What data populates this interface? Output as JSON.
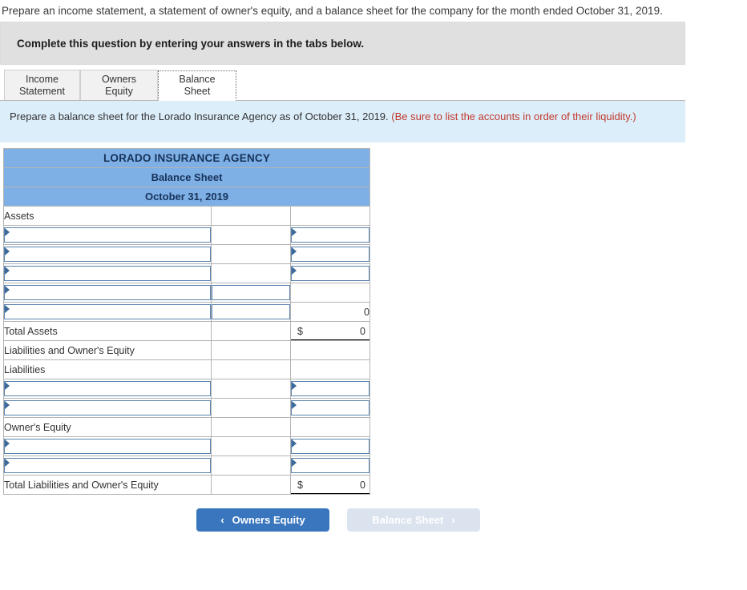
{
  "prompt": {
    "text": "Prepare an income statement, a statement of owner's equity, and a balance sheet for the company for the month ended October 31, 2019."
  },
  "gray_banner": {
    "text": "Complete this question by entering your answers in the tabs below."
  },
  "tabs": {
    "items": [
      {
        "label": "Income\nStatement",
        "active": false
      },
      {
        "label": "Owners Equity",
        "active": false
      },
      {
        "label": "Balance Sheet",
        "active": true
      }
    ]
  },
  "blue_banner": {
    "text": "Prepare a balance sheet for the Lorado Insurance Agency as of October 31, 2019. ",
    "hint": "(Be sure to list the accounts in order of their liquidity.)"
  },
  "sheet": {
    "title_line1": "LORADO INSURANCE AGENCY",
    "title_line2": "Balance Sheet",
    "title_line3": "October 31, 2019",
    "rows": [
      {
        "type": "label",
        "label": "Assets",
        "mid": "",
        "right": ""
      },
      {
        "type": "input_right",
        "label": "",
        "mid": "",
        "right": ""
      },
      {
        "type": "input_right",
        "label": "",
        "mid": "",
        "right": ""
      },
      {
        "type": "input_right",
        "label": "",
        "mid": "",
        "right": ""
      },
      {
        "type": "input_mid",
        "label": "",
        "mid": "",
        "right": ""
      },
      {
        "type": "input_mid_value",
        "label": "",
        "mid": "",
        "right": "0"
      },
      {
        "type": "total",
        "label": "Total Assets",
        "currency": "$",
        "right": "0"
      },
      {
        "type": "label",
        "label": "Liabilities and Owner's Equity",
        "mid": "",
        "right": ""
      },
      {
        "type": "label",
        "label": "Liabilities",
        "mid": "",
        "right": ""
      },
      {
        "type": "input_right",
        "label": "",
        "mid": "",
        "right": ""
      },
      {
        "type": "input_right",
        "label": "",
        "mid": "",
        "right": ""
      },
      {
        "type": "label",
        "label": "Owner's Equity",
        "mid": "",
        "right": ""
      },
      {
        "type": "input_right",
        "label": "",
        "mid": "",
        "right": ""
      },
      {
        "type": "input_right",
        "label": "",
        "mid": "",
        "right": ""
      },
      {
        "type": "total",
        "label": "Total Liabilities and Owner's Equity",
        "currency": "$",
        "right": "0"
      }
    ]
  },
  "nav": {
    "prev_label": "Owners Equity",
    "prev_icon": "chevron-left-icon",
    "prev_chevron": "‹",
    "next_label": "Balance Sheet",
    "next_icon": "chevron-right-icon",
    "next_chevron": "›"
  },
  "colors": {
    "header_blue": "#7eb0e6",
    "banner_blue": "#ddeefb",
    "banner_gray": "#e0e0e0",
    "accent_blue": "#3a76bd",
    "hint_red": "#c0392b",
    "input_border": "#5a84ae"
  }
}
